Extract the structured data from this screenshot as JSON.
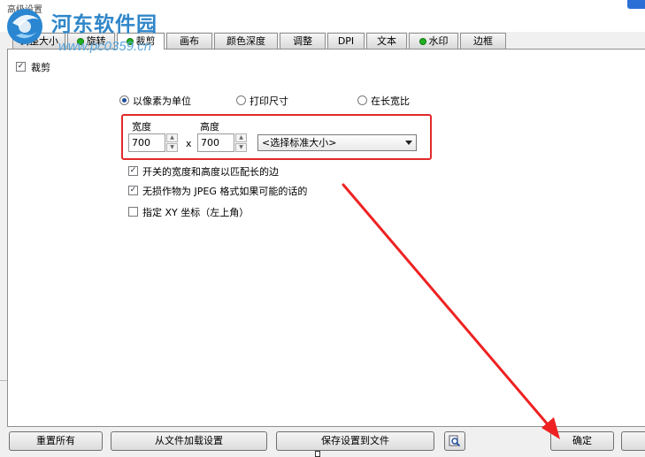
{
  "window": {
    "title": "高级设置"
  },
  "watermark": {
    "title": "河东软件园",
    "url": "www.pc0359.cn"
  },
  "tabs": [
    {
      "label": "调整大小",
      "dot": false
    },
    {
      "label": "旋转",
      "dot": true
    },
    {
      "label": "裁剪",
      "dot": true,
      "active": true
    },
    {
      "label": "画布",
      "dot": false
    },
    {
      "label": "颜色深度",
      "dot": false
    },
    {
      "label": "调整",
      "dot": false
    },
    {
      "label": "DPI",
      "dot": false
    },
    {
      "label": "文本",
      "dot": false
    },
    {
      "label": "水印",
      "dot": true
    },
    {
      "label": "边框",
      "dot": false
    }
  ],
  "crop": {
    "enable_label": "裁剪",
    "enable_checked": true,
    "units": {
      "pixels": "以像素为单位",
      "print_size": "打印尺寸",
      "aspect_ratio": "在长宽比",
      "selected": "pixels"
    },
    "width_label": "宽度",
    "height_label": "高度",
    "width_value": "700",
    "height_value": "700",
    "times": "x",
    "size_select": "<选择标准大小>",
    "options": [
      {
        "label": "开关的宽度和高度以匹配长的边",
        "checked": true
      },
      {
        "label": "无损作物为 JPEG 格式如果可能的话的",
        "checked": true
      },
      {
        "label": "指定 XY 坐标（左上角）",
        "checked": false
      }
    ]
  },
  "buttons": {
    "reset_all": "重置所有",
    "load_from_file": "从文件加载设置",
    "save_to_file": "保存设置到文件",
    "ok": "确定"
  },
  "colors": {
    "highlight": "#e12a2a",
    "tab_dot": "#22b022",
    "accent": "#2f86c9"
  },
  "icons": {
    "preview": "magnifier-page-icon",
    "logo": "blue-logo-icon"
  }
}
